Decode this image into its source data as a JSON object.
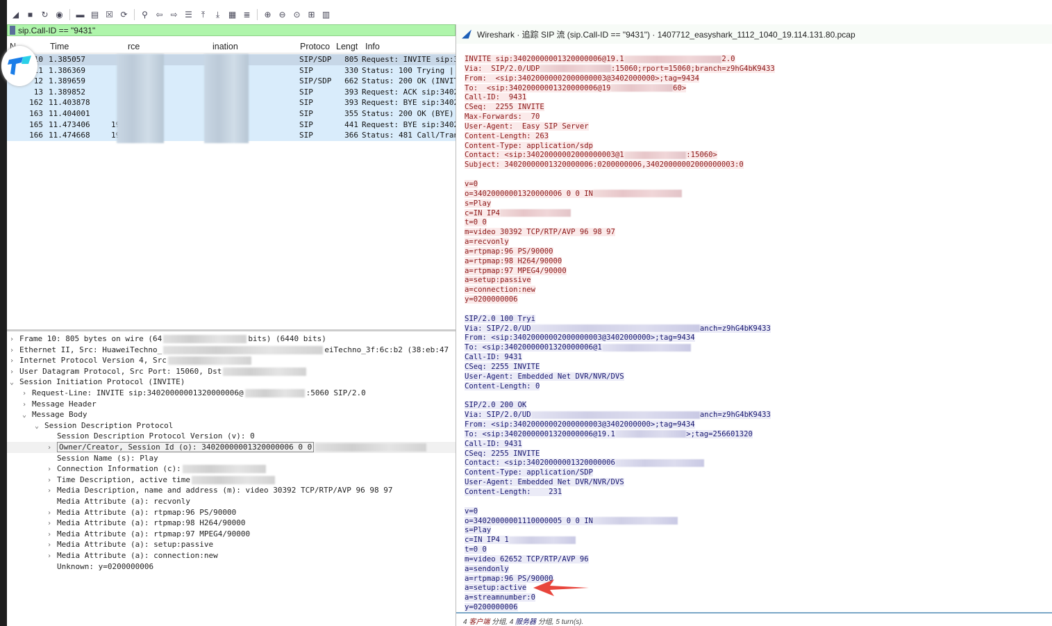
{
  "toolbar": {
    "icons": [
      "shark-fin-icon",
      "stop-icon",
      "restart-icon",
      "options-icon",
      "open-folder-icon",
      "save-icon",
      "close-file-icon",
      "reload-icon",
      "find-icon",
      "back-icon",
      "forward-icon",
      "goto-icon",
      "first-icon",
      "last-icon",
      "autoscroll-icon",
      "colorize-icon",
      "zoom-in-icon",
      "zoom-out-icon",
      "zoom-reset-icon",
      "resize-columns-icon",
      "layout-icon"
    ]
  },
  "filter": {
    "value": "sip.Call-ID == \"9431\""
  },
  "packet_list": {
    "columns": [
      "No.",
      "Time",
      "Source",
      "Destination",
      "Protocol",
      "Length",
      "Info"
    ],
    "column_labels": {
      "no": "N",
      "time": "Time",
      "source": "rce",
      "destination": "ination",
      "protocol": "Protoco",
      "length": "Lengt",
      "info": "Info"
    },
    "rows": [
      {
        "no": "10",
        "time": "1.385057",
        "src": "",
        "proto": "SIP/SDP",
        "len": "805",
        "info": "Request: INVITE sip:3"
      },
      {
        "no": "11",
        "time": "1.386369",
        "src": "",
        "proto": "SIP",
        "len": "330",
        "info": "Status: 100 Trying |"
      },
      {
        "no": "12",
        "time": "1.389659",
        "src": "",
        "proto": "SIP/SDP",
        "len": "662",
        "info": "Status: 200 OK (INVIT"
      },
      {
        "no": "13",
        "time": "1.389852",
        "src": "",
        "proto": "SIP",
        "len": "393",
        "info": "Request: ACK sip:3402"
      },
      {
        "no": "162",
        "time": "11.403878",
        "src": "",
        "proto": "SIP",
        "len": "393",
        "info": "Request: BYE sip:3402"
      },
      {
        "no": "163",
        "time": "11.404001",
        "src": "",
        "proto": "SIP",
        "len": "355",
        "info": "Status: 200 OK (BYE)"
      },
      {
        "no": "165",
        "time": "11.473406",
        "src": "19",
        "proto": "SIP",
        "len": "441",
        "info": "Request: BYE sip:3402"
      },
      {
        "no": "166",
        "time": "11.474668",
        "src": "19",
        "proto": "SIP",
        "len": "366",
        "info": "Status: 481 Call/Tran"
      }
    ]
  },
  "details": [
    {
      "indent": 0,
      "arrow": ">",
      "text": "Frame 10: 805 bytes on wire (64",
      "tail": "bits) (6440 bits)"
    },
    {
      "indent": 0,
      "arrow": ">",
      "text": "Ethernet II, Src: HuaweiTechno_",
      "tail": "eiTechno_3f:6c:b2 (38:eb:47"
    },
    {
      "indent": 0,
      "arrow": ">",
      "text": "Internet Protocol Version 4, Src",
      "tail": ""
    },
    {
      "indent": 0,
      "arrow": ">",
      "text": "User Datagram Protocol, Src Port: 15060, Dst",
      "tail": ""
    },
    {
      "indent": 0,
      "arrow": "v",
      "text": "Session Initiation Protocol (INVITE)",
      "tail": ""
    },
    {
      "indent": 1,
      "arrow": ">",
      "text": "Request-Line: INVITE sip:34020000001320000006@",
      "tail": ":5060 SIP/2.0"
    },
    {
      "indent": 1,
      "arrow": ">",
      "text": "Message Header",
      "tail": ""
    },
    {
      "indent": 1,
      "arrow": "v",
      "text": "Message Body",
      "tail": ""
    },
    {
      "indent": 2,
      "arrow": "v",
      "text": "Session Description Protocol",
      "tail": ""
    },
    {
      "indent": 3,
      "arrow": "",
      "text": "Session Description Protocol Version (v): 0",
      "tail": ""
    },
    {
      "indent": 3,
      "arrow": ">",
      "text": "Owner/Creator, Session Id (o): 34020000001320000006 0 0",
      "tail": ""
    },
    {
      "indent": 3,
      "arrow": "",
      "text": "Session Name (s): Play",
      "tail": ""
    },
    {
      "indent": 3,
      "arrow": ">",
      "text": "Connection Information (c):",
      "tail": ""
    },
    {
      "indent": 3,
      "arrow": ">",
      "text": "Time Description, active time",
      "tail": ""
    },
    {
      "indent": 3,
      "arrow": ">",
      "text": "Media Description, name and address (m): video 30392 TCP/RTP/AVP 96 98 97",
      "tail": ""
    },
    {
      "indent": 3,
      "arrow": "",
      "text": "Media Attribute (a): recvonly",
      "tail": ""
    },
    {
      "indent": 3,
      "arrow": ">",
      "text": "Media Attribute (a): rtpmap:96 PS/90000",
      "tail": ""
    },
    {
      "indent": 3,
      "arrow": ">",
      "text": "Media Attribute (a): rtpmap:98 H264/90000",
      "tail": ""
    },
    {
      "indent": 3,
      "arrow": ">",
      "text": "Media Attribute (a): rtpmap:97 MPEG4/90000",
      "tail": ""
    },
    {
      "indent": 3,
      "arrow": ">",
      "text": "Media Attribute (a): setup:passive",
      "tail": ""
    },
    {
      "indent": 3,
      "arrow": ">",
      "text": "Media Attribute (a): connection:new",
      "tail": ""
    },
    {
      "indent": 3,
      "arrow": "",
      "text": "Unknown: y=0200000006",
      "tail": ""
    }
  ],
  "follow_window": {
    "title": "Wireshark · 追踪 SIP 流 (sip.Call-ID == \"9431\") · 1407712_easyshark_1112_1040_19.114.131.80.pcap",
    "lines": [
      {
        "side": "c",
        "text": "INVITE sip:34020000001320000006@19.1",
        "blur": 22,
        "tail": "2.0"
      },
      {
        "side": "c",
        "text": "Via:  SIP/2.0/UDP",
        "blur": 16,
        "tail": ":15060;rport=15060;branch=z9hG4bK9433"
      },
      {
        "side": "c",
        "text": "From:  <sip:34020000002000000003@3402000000>;tag=9434"
      },
      {
        "side": "c",
        "text": "To:  <sip:34020000001320000006@19",
        "blur": 14,
        "tail": "60>"
      },
      {
        "side": "c",
        "text": "Call-ID:  9431"
      },
      {
        "side": "c",
        "text": "CSeq:  2255 INVITE"
      },
      {
        "side": "c",
        "text": "Max-Forwards:  70"
      },
      {
        "side": "c",
        "text": "User-Agent:  Easy SIP Server"
      },
      {
        "side": "c",
        "text": "Content-Length: 263"
      },
      {
        "side": "c",
        "text": "Content-Type: application/sdp"
      },
      {
        "side": "c",
        "text": "Contact: <sip:34020000002000000003@1",
        "blur": 14,
        "tail": ":15060>"
      },
      {
        "side": "c",
        "text": "Subject: 34020000001320000006:0200000006,34020000002000000003:0"
      },
      {
        "side": "",
        "text": ""
      },
      {
        "side": "c",
        "text": "v=0"
      },
      {
        "side": "c",
        "text": "o=34020000001320000006 0 0 IN",
        "blur": 20,
        "tail": ""
      },
      {
        "side": "c",
        "text": "s=Play"
      },
      {
        "side": "c",
        "text": "c=IN IP4",
        "blur": 16,
        "tail": ""
      },
      {
        "side": "c",
        "text": "t=0 0"
      },
      {
        "side": "c",
        "text": "m=video 30392 TCP/RTP/AVP 96 98 97"
      },
      {
        "side": "c",
        "text": "a=recvonly"
      },
      {
        "side": "c",
        "text": "a=rtpmap:96 PS/90000"
      },
      {
        "side": "c",
        "text": "a=rtpmap:98 H264/90000"
      },
      {
        "side": "c",
        "text": "a=rtpmap:97 MPEG4/90000"
      },
      {
        "side": "c",
        "text": "a=setup:passive"
      },
      {
        "side": "c",
        "text": "a=connection:new"
      },
      {
        "side": "c",
        "text": "y=0200000006"
      },
      {
        "side": "",
        "text": ""
      },
      {
        "side": "s",
        "text": "SIP/2.0 100 Tryi",
        "blur": 0,
        "tail": ""
      },
      {
        "side": "s",
        "text": "Via: SIP/2.0/UD",
        "blur": 38,
        "tail": "anch=z9hG4bK9433"
      },
      {
        "side": "s",
        "text": "From: <sip:34020000002000000003@3402000000>;tag=9434"
      },
      {
        "side": "s",
        "text": "To: <sip:34020000001320000006@1",
        "blur": 20,
        "tail": ""
      },
      {
        "side": "s",
        "text": "Call-ID: 9431"
      },
      {
        "side": "s",
        "text": "CSeq: 2255 INVITE"
      },
      {
        "side": "s",
        "text": "User-Agent: Embedded Net DVR/NVR/DVS"
      },
      {
        "side": "s",
        "text": "Content-Length: 0"
      },
      {
        "side": "",
        "text": ""
      },
      {
        "side": "s",
        "text": "SIP/2.0 200 OK"
      },
      {
        "side": "s",
        "text": "Via: SIP/2.0/UD",
        "blur": 38,
        "tail": "anch=z9hG4bK9433"
      },
      {
        "side": "s",
        "text": "From: <sip:34020000002000000003@3402000000>;tag=9434"
      },
      {
        "side": "s",
        "text": "To: <sip:34020000001320000006@19.1",
        "blur": 16,
        "tail": ">;tag=256601320"
      },
      {
        "side": "s",
        "text": "Call-ID: 9431"
      },
      {
        "side": "s",
        "text": "CSeq: 2255 INVITE"
      },
      {
        "side": "s",
        "text": "Contact: <sip:34020000001320000006",
        "blur": 20,
        "tail": ""
      },
      {
        "side": "s",
        "text": "Content-Type: application/SDP"
      },
      {
        "side": "s",
        "text": "User-Agent: Embedded Net DVR/NVR/DVS"
      },
      {
        "side": "s",
        "text": "Content-Length:    231"
      },
      {
        "side": "",
        "text": ""
      },
      {
        "side": "s",
        "text": "v=0"
      },
      {
        "side": "s",
        "text": "o=34020000001110000005 0 0 IN",
        "blur": 19,
        "tail": ""
      },
      {
        "side": "s",
        "text": "s=Play"
      },
      {
        "side": "s",
        "text": "c=IN IP4 1",
        "blur": 15,
        "tail": ""
      },
      {
        "side": "s",
        "text": "t=0 0"
      },
      {
        "side": "s",
        "text": "m=video 62652 TCP/RTP/AVP 96"
      },
      {
        "side": "s",
        "text": "a=sendonly"
      },
      {
        "side": "s",
        "text": "a=rtpmap:96 PS/90000"
      },
      {
        "side": "s",
        "text": "a=setup:active"
      },
      {
        "side": "s",
        "text": "a=streamnumber:0"
      },
      {
        "side": "s",
        "text": "y=0200000006"
      }
    ],
    "status": {
      "count1": "4",
      "client_label": "客户端",
      "packets1": "分组,",
      "count2": "4",
      "server_label": "服务器",
      "packets2": "分组,",
      "turns": "5 turn(s)."
    }
  },
  "colors": {
    "client_text": "#8a1414",
    "server_text": "#14146e",
    "filter_bg": "#aff5ab",
    "annotation_arrow": "#e8453c"
  }
}
